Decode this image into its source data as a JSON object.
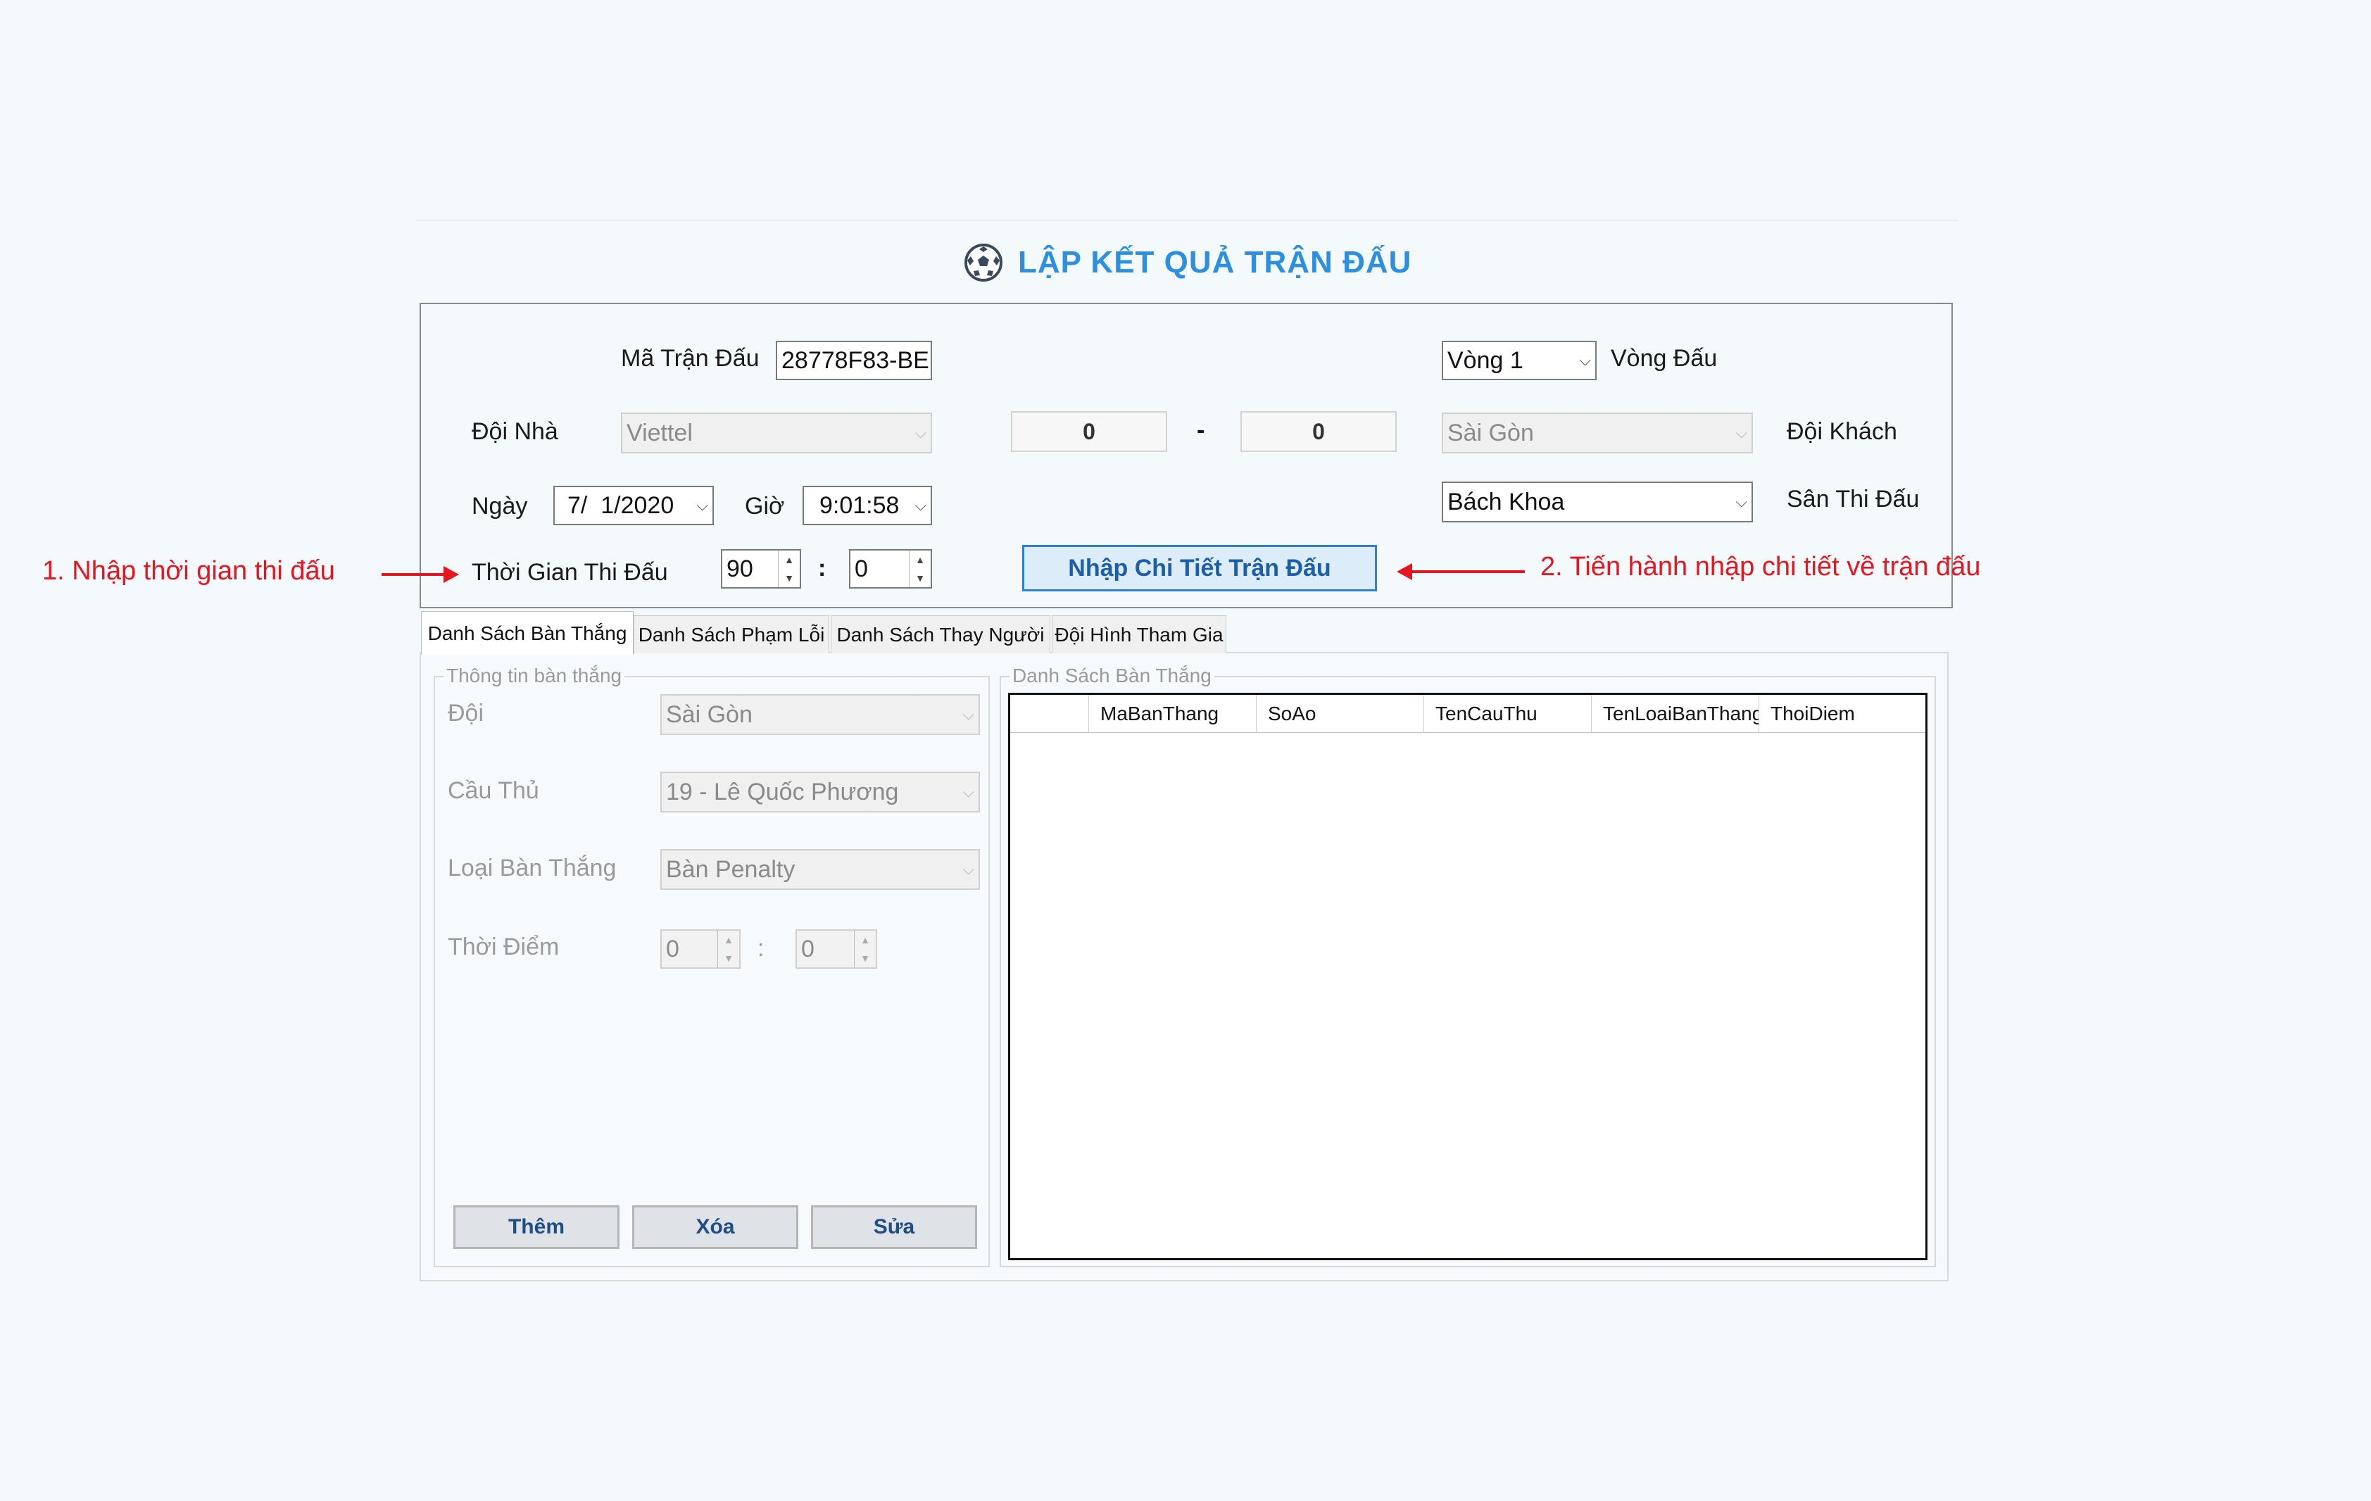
{
  "title": "LẬP KẾT QUẢ TRẬN ĐẤU",
  "match": {
    "id_label": "Mã Trận Đấu",
    "id_value": "28778F83-BE",
    "round_value": "Vòng 1",
    "round_label": "Vòng Đấu",
    "home_label": "Đội Nhà",
    "home_value": "Viettel",
    "home_score": "0",
    "dash": "-",
    "away_score": "0",
    "away_value": "Sài Gòn",
    "away_label": "Đội Khách",
    "date_label": "Ngày",
    "date_value": "7/  1/2020",
    "time_label": "Giờ",
    "time_value": "9:01:58",
    "stadium_value": "Bách Khoa",
    "stadium_label": "Sân Thi Đấu",
    "duration_label": "Thời Gian Thi Đấu",
    "duration_min": "90",
    "colon": ":",
    "duration_sec": "0",
    "detail_button": "Nhập Chi Tiết Trận Đấu"
  },
  "annotations": {
    "left": "1. Nhập thời gian thi đấu",
    "right": "2. Tiến hành nhập chi tiết về trận đấu"
  },
  "tabs": [
    "Danh Sách Bàn Thắng",
    "Danh Sách Phạm Lỗi",
    "Danh Sách Thay Người",
    "Đội Hình Tham Gia"
  ],
  "goal_info": {
    "legend": "Thông tin bàn thắng",
    "team_label": "Đội",
    "team_value": "Sài Gòn",
    "player_label": "Cầu Thủ",
    "player_value": "19 - Lê Quốc Phương",
    "type_label": "Loại Bàn Thắng",
    "type_value": "Bàn Penalty",
    "time_label": "Thời Điểm",
    "time_min": "0",
    "colon": ":",
    "time_sec": "0"
  },
  "goal_list": {
    "legend": "Danh Sách Bàn Thắng",
    "columns": [
      "MaBanThang",
      "SoAo",
      "TenCauThu",
      "TenLoaiBanThang",
      "ThoiDiem"
    ]
  },
  "buttons": {
    "add": "Thêm",
    "delete": "Xóa",
    "edit": "Sửa"
  },
  "colors": {
    "accent": "#2e8fe0",
    "annotation": "#e8141e",
    "button_text": "#1f4e87"
  }
}
